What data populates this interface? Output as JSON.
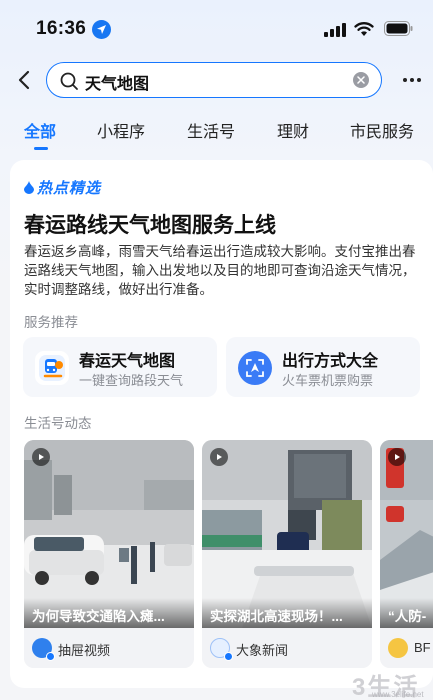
{
  "status_bar": {
    "time": "16:36"
  },
  "search": {
    "query": "天气地图"
  },
  "tabs": [
    {
      "label": "全部",
      "active": true
    },
    {
      "label": "小程序"
    },
    {
      "label": "生活号"
    },
    {
      "label": "理财"
    },
    {
      "label": "市民服务"
    }
  ],
  "hot": {
    "badge": "热点精选",
    "headline": "春运路线天气地图服务上线",
    "summary": "春运返乡高峰，雨雪天气给春运出行造成较大影响。支付宝推出春运路线天气地图，输入出发地以及目的地即可查询沿途天气情况，实时调整路线，做好出行准备。"
  },
  "services": {
    "section_label": "服务推荐",
    "items": [
      {
        "title": "春运天气地图",
        "subtitle": "一键查询路段天气",
        "icon": "train-icon"
      },
      {
        "title": "出行方式大全",
        "subtitle": "火车票机票购票",
        "icon": "travel-compass-icon"
      }
    ]
  },
  "feed": {
    "section_label": "生活号动态",
    "videos": [
      {
        "caption": "为何导致交通陷入瘫...",
        "source": "抽屉视频"
      },
      {
        "caption": "实探湖北高速现场！...",
        "source": "大象新闻"
      },
      {
        "caption": "“人防-",
        "source": "BF"
      }
    ]
  },
  "watermark": {
    "text": "3生活",
    "url": "www.3elife.net"
  },
  "colors": {
    "accent": "#1677ff",
    "card": "#ffffff",
    "muted": "#8a8d94"
  }
}
